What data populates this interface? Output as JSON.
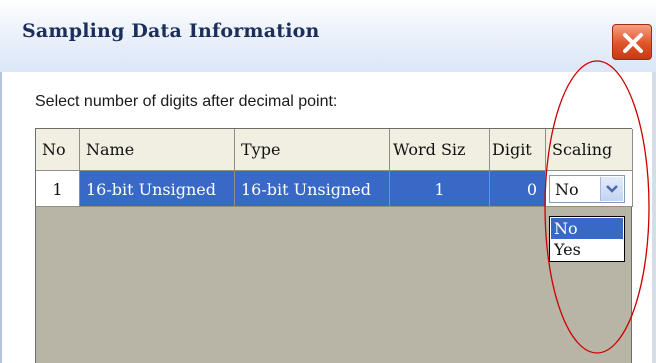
{
  "dialog": {
    "title": "Sampling Data Information",
    "prompt": "Select number of digits after decimal point:"
  },
  "table": {
    "columns": [
      "No",
      "Name",
      "Type",
      "Word Size",
      "Digit",
      "Scaling"
    ],
    "columns_visible": [
      "No",
      "Name",
      "Type",
      "Word Siz",
      "Digit",
      "Scaling"
    ],
    "rows": [
      {
        "no": "1",
        "name": "16-bit Unsigned",
        "type": "16-bit Unsigned",
        "word_size": "1",
        "digit": "0",
        "scaling": "No"
      }
    ],
    "rows_visible": [
      {
        "name": "16-bit Unsigned",
        "type": "16-bit Unsigned"
      }
    ]
  },
  "scaling_dropdown": {
    "selected": "No",
    "options": [
      "No",
      "Yes"
    ],
    "highlighted": "No"
  },
  "colors": {
    "selection": "#3969c6",
    "grid_background": "#b8b4a6",
    "header_background": "#f1efe2",
    "close_button": "#e0532a",
    "annotation": "#cc0000"
  }
}
